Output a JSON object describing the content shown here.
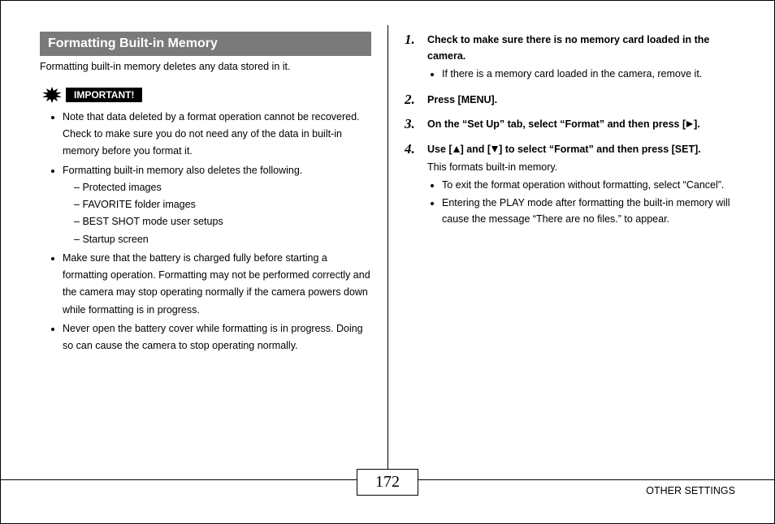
{
  "section_title": "Formatting Built-in Memory",
  "intro": "Formatting built-in memory deletes any data stored in it.",
  "important_label": "IMPORTANT!",
  "important_bullets": [
    "Note that data deleted by a format operation cannot be recovered. Check to make sure you do not need any of the data in built-in memory before you format it.",
    "Formatting built-in memory also deletes the following.",
    "Make sure that the battery is charged fully before starting a formatting operation. Formatting may not be performed correctly and the camera may stop operating normally if the camera powers down while formatting is in progress.",
    "Never open the battery cover while formatting is in progress. Doing so can cause the camera to stop operating normally."
  ],
  "deleted_items": [
    "Protected images",
    "FAVORITE folder images",
    "BEST SHOT mode user setups",
    "Startup screen"
  ],
  "steps": [
    {
      "num": "1.",
      "head": "Check to make sure there is no memory card loaded in the camera.",
      "bullets": [
        "If there is a memory card loaded in the camera, remove it."
      ]
    },
    {
      "num": "2.",
      "head": "Press [MENU]."
    },
    {
      "num": "3.",
      "head_pre": "On the “Set Up” tab, select “Format” and then press [",
      "head_post": "]."
    },
    {
      "num": "4.",
      "head_pre": "Use [",
      "head_mid": "] and [",
      "head_post": "] to select “Format” and then press [SET].",
      "sub": "This formats built-in memory.",
      "bullets": [
        "To exit the format operation without formatting, select “Cancel”.",
        "Entering the PLAY mode after formatting the built-in memory will cause the message “There are no files.” to appear."
      ]
    }
  ],
  "footer": {
    "section": "OTHER SETTINGS",
    "page": "172"
  }
}
